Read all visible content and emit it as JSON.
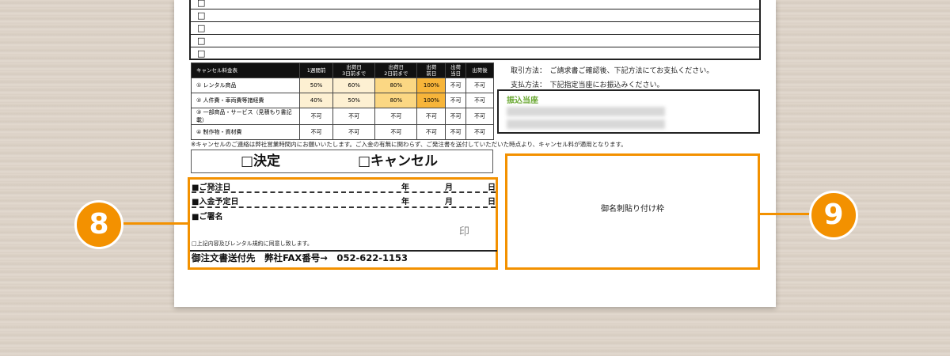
{
  "top_rows": [
    "□",
    "□",
    "□",
    "□",
    "□"
  ],
  "cancel_table": {
    "headers": [
      "キャンセル料金表",
      "1週間前",
      "出荷日\n3日前まで",
      "出荷日\n2日前まで",
      "出荷\n前日",
      "出荷\n当日",
      "出荷後"
    ],
    "rows": [
      {
        "label": "① レンタル商品",
        "cells": [
          "50%",
          "60%",
          "80%",
          "100%",
          "不可",
          "不可"
        ]
      },
      {
        "label": "② 人件費・車両費等諸経費",
        "cells": [
          "40%",
          "50%",
          "80%",
          "100%",
          "不可",
          "不可"
        ]
      },
      {
        "label": "③ 一部商品・サービス（見積もり書記載）",
        "cells": [
          "不可",
          "不可",
          "不可",
          "不可",
          "不可",
          "不可"
        ]
      },
      {
        "label": "④ 制作物・資材費",
        "cells": [
          "不可",
          "不可",
          "不可",
          "不可",
          "不可",
          "不可"
        ]
      }
    ]
  },
  "payment": {
    "method": "取引方法：　ご請求書ご確認後、下記方法にてお支払ください。",
    "payment_method": "支払方法：　下記指定当座にお振込みください。",
    "bank_title": "振込当座"
  },
  "notice": "※キャンセルのご連絡は弊社営業時間内にお願いいたします。ご入金の有無に関わらず、ご発注書を送付していただいた時点より、キャンセル料が適用となります。",
  "decision": {
    "decide": "□決定",
    "cancel": "□キャンセル"
  },
  "form": {
    "order_date": "■ご発注日",
    "payment_date": "■入金予定日",
    "signature": "■ご署名",
    "year": "年",
    "month": "月",
    "day": "日",
    "seal": "印",
    "agree": "□上記内容及びレンタル規約に同意し致します。",
    "send_to": "御注文書送付先　弊社FAX番号→　052-622-1153"
  },
  "meishi": "御名刺貼り付け枠",
  "badges": {
    "left": "8",
    "right": "9"
  },
  "colors": {
    "accent": "#f39100",
    "bank_title": "#6aa832"
  }
}
